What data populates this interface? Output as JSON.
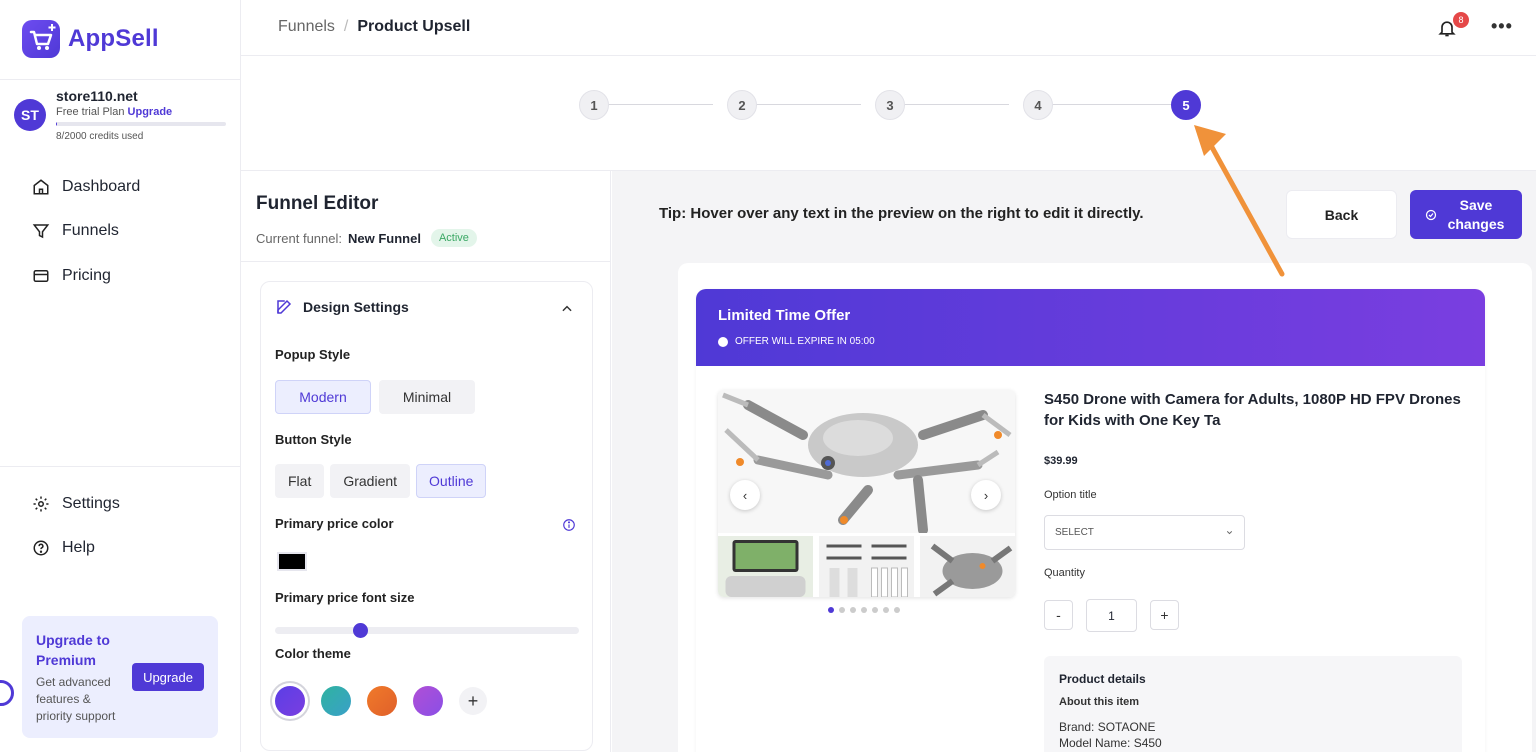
{
  "app": {
    "name": "AppSell"
  },
  "store": {
    "avatar_initials": "ST",
    "name": "store110.net",
    "plan_label": "Free trial Plan",
    "upgrade_link": "Upgrade",
    "credits_text": "8/2000 credits used",
    "credits_used": 8,
    "credits_total": 2000
  },
  "nav": {
    "dashboard": "Dashboard",
    "funnels": "Funnels",
    "pricing": "Pricing",
    "settings": "Settings",
    "help": "Help"
  },
  "upgrade_card": {
    "title": "Upgrade to Premium",
    "description": "Get advanced features & priority support",
    "button": "Upgrade"
  },
  "breadcrumb": {
    "parent": "Funnels",
    "separator": "/",
    "current": "Product Upsell"
  },
  "notifications": {
    "count": "8"
  },
  "steps": {
    "items": [
      "1",
      "2",
      "3",
      "4",
      "5"
    ],
    "active": "5"
  },
  "editor": {
    "title": "Funnel Editor",
    "current_label": "Current funnel:",
    "current_name": "New Funnel",
    "status": "Active",
    "design_settings": {
      "title": "Design Settings",
      "popup_style_label": "Popup Style",
      "popup_styles": [
        "Modern",
        "Minimal"
      ],
      "popup_style_selected": "Modern",
      "button_style_label": "Button Style",
      "button_styles": [
        "Flat",
        "Gradient",
        "Outline"
      ],
      "button_style_selected": "Outline",
      "price_color_label": "Primary price color",
      "price_color": "#000000",
      "font_size_label": "Primary price font size",
      "font_size_level": 0.28,
      "color_theme_label": "Color theme",
      "themes": [
        "#5b3ee6",
        "#2fb3a0",
        "#f07a2a",
        "#b04fd6"
      ]
    }
  },
  "preview_toolbar": {
    "tip": "Tip: Hover over any text in the preview on the right to edit it directly.",
    "back": "Back",
    "save": "Save changes"
  },
  "popup": {
    "title": "Limited Time Offer",
    "timer": "OFFER WILL EXPIRE IN 05:00",
    "product_title": "S450 Drone with Camera for Adults, 1080P HD FPV Drones for Kids with One Key Ta",
    "price": "$39.99",
    "option_label": "Option title",
    "select_value": "SELECT",
    "quantity_label": "Quantity",
    "quantity": "1",
    "minus": "-",
    "plus": "+",
    "details_title": "Product details",
    "about": "About this item",
    "brand": "Brand: SOTAONE",
    "model": "Model Name: S450",
    "gallery_dots": 7
  },
  "colors": {
    "accent": "#4f39d6",
    "annotation": "#f0923a"
  }
}
